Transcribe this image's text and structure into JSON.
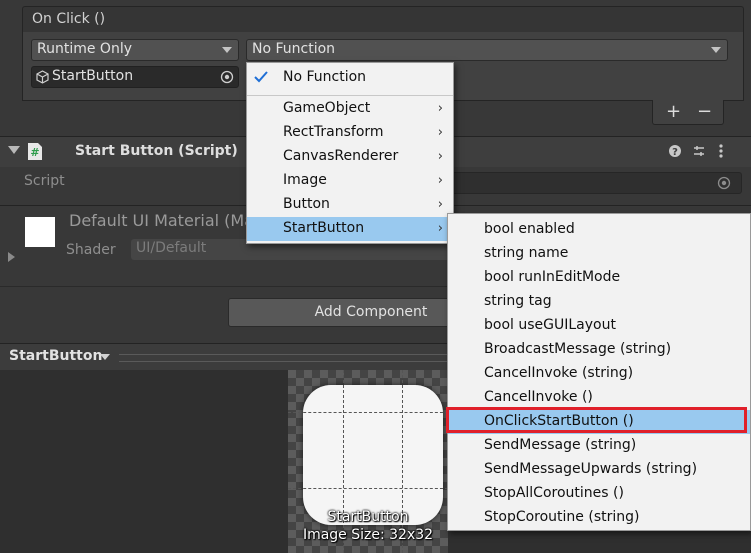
{
  "on_click": {
    "header": "On Click ()",
    "runtime_dropdown": "Runtime Only",
    "function_dropdown": "No Function",
    "object_field": "StartButton",
    "plus_label": "+",
    "minus_label": "−"
  },
  "script_component": {
    "title": "Start Button (Script)",
    "script_label": "Script"
  },
  "material": {
    "name": "Default UI Material (Ma",
    "shader_label": "Shader",
    "shader_value": "UI/Default"
  },
  "add_component_label": "Add Component",
  "preview": {
    "title": "StartButton",
    "image_name": "StartButton",
    "image_size": "Image Size: 32x32"
  },
  "function_menu": {
    "items": [
      {
        "label": "No Function",
        "checked": true
      },
      {
        "label": "GameObject"
      },
      {
        "label": "RectTransform"
      },
      {
        "label": "CanvasRenderer"
      },
      {
        "label": "Image"
      },
      {
        "label": "Button"
      },
      {
        "label": "StartButton",
        "highlighted": true
      }
    ]
  },
  "submenu": {
    "items": [
      {
        "label": "bool enabled"
      },
      {
        "label": "string name"
      },
      {
        "label": "bool runInEditMode"
      },
      {
        "label": "string tag"
      },
      {
        "label": "bool useGUILayout"
      },
      {
        "label": "BroadcastMessage (string)"
      },
      {
        "label": "CancelInvoke (string)"
      },
      {
        "label": "CancelInvoke ()"
      },
      {
        "label": "OnClickStartButton ()",
        "highlighted": true
      },
      {
        "label": "SendMessage (string)"
      },
      {
        "label": "SendMessageUpwards (string)"
      },
      {
        "label": "StopAllCoroutines ()"
      },
      {
        "label": "StopCoroutine (string)"
      }
    ]
  },
  "colors": {
    "highlight": "#99c9ef",
    "annotation_box": "#e0202a",
    "menu_bg": "#f2f2f2"
  }
}
